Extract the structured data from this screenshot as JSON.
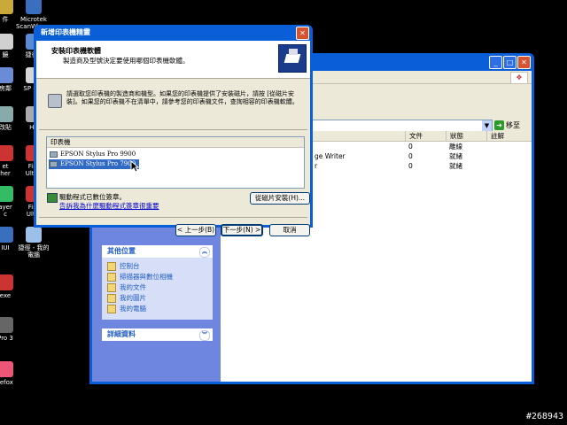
{
  "desktop": {
    "icons": [
      {
        "label": "件",
        "color": "#c8a93a"
      },
      {
        "label": "Microtek\nScanWiza...",
        "color": "#3a6fbf"
      },
      {
        "label": "鏡",
        "color": "#d0d0d0"
      },
      {
        "label": "捷徑 -",
        "color": "#5a8bd6"
      },
      {
        "label": "房鄰",
        "color": "#6a8bd6"
      },
      {
        "label": "SP Lay",
        "color": "#d6d6d6"
      },
      {
        "label": "改貼",
        "color": "#8aa"
      },
      {
        "label": "Hu",
        "color": "#aaa"
      },
      {
        "label": "et\nher",
        "color": "#c33"
      },
      {
        "label": "Fire\nUltim",
        "color": "#c33"
      },
      {
        "label": "ayer\nc",
        "color": "#3b6"
      },
      {
        "label": "Fire\nUltin",
        "color": "#c33"
      },
      {
        "label": "IUI",
        "color": "#3a6fbf"
      },
      {
        "label": "捷徑 - 我的\n電腦",
        "color": "#9cc0ea"
      },
      {
        "label": "exe",
        "color": "#c33"
      },
      {
        "label": "Pro 3",
        "color": "#666"
      },
      {
        "label": "refox",
        "color": "#e57"
      }
    ],
    "watermark": "#268943"
  },
  "explorer": {
    "go_label": "移至",
    "columns": [
      "文件",
      "狀態",
      "註解"
    ],
    "rows": [
      {
        "name": "",
        "docs": "0",
        "status": "離線"
      },
      {
        "name": "ge Writer",
        "docs": "0",
        "status": "就緒"
      },
      {
        "name": "r",
        "docs": "0",
        "status": "就緒"
      }
    ],
    "other_places": {
      "title": "其他位置",
      "links": [
        "控制台",
        "掃描器與數位相機",
        "我的文件",
        "我的圖片",
        "我的電腦"
      ]
    },
    "details": {
      "title": "詳細資料"
    }
  },
  "dialog": {
    "title": "新增印表機精靈",
    "header_title": "安裝印表機軟體",
    "header_sub": "製造商及型號決定要使用哪個印表機軟體。",
    "instruction": "請選取您印表機的製造商和機型。如果您的印表機提供了安裝磁片，請按 [從磁片安裝]。如果您的印表機不在清單中，請參考您的印表機文件，查詢相容的印表機軟體。",
    "list_header": "印表機",
    "printers": [
      {
        "name": "EPSON Stylus Pro 9900",
        "selected": false
      },
      {
        "name": "EPSON Stylus Pro 7900",
        "selected": true
      }
    ],
    "signed_text": "驅動程式已數位簽章。",
    "signed_link": "告訴我為什麼驅動程式簽章很重要",
    "have_disk": "從磁片安裝(H)...",
    "back": "< 上一步(B)",
    "next": "下一步(N) >",
    "cancel": "取消"
  }
}
